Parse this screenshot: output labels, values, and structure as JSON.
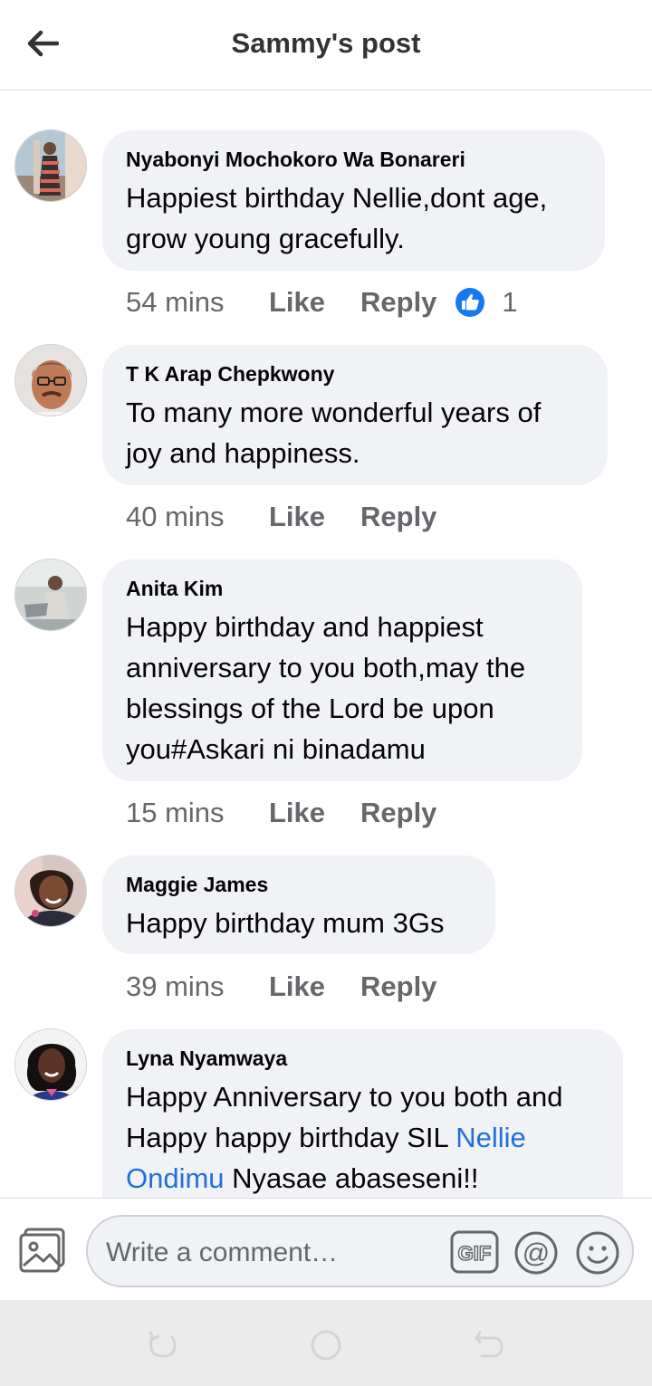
{
  "header": {
    "title": "Sammy's post"
  },
  "comments": [
    {
      "author": "Nyabonyi Mochokoro Wa Bonareri",
      "lines": [
        "Happiest birthday Nellie,dont age,",
        "grow young gracefully."
      ],
      "time": "54 mins",
      "like_label": "Like",
      "reply_label": "Reply",
      "reaction": {
        "icon": "thumbs-up-icon",
        "count": "1"
      }
    },
    {
      "author": "T K Arap Chepkwony",
      "lines": [
        "To many more wonderful years of",
        "joy and happiness."
      ],
      "time": "40 mins",
      "like_label": "Like",
      "reply_label": "Reply"
    },
    {
      "author": "Anita Kim",
      "lines": [
        "Happy birthday and happiest",
        "anniversary to you both,may the",
        "blessings of the Lord be upon",
        "you#Askari ni binadamu"
      ],
      "time": "15 mins",
      "like_label": "Like",
      "reply_label": "Reply"
    },
    {
      "author": "Maggie James",
      "lines": [
        "Happy birthday mum 3Gs"
      ],
      "time": "39 mins",
      "like_label": "Like",
      "reply_label": "Reply"
    },
    {
      "author": "Lyna Nyamwaya",
      "line1": "Happy Anniversary to you both and",
      "line2_pre": "Happy happy birthday SIL ",
      "mention_part1": "Nellie",
      "mention_part2": "Ondimu",
      "line3_post": " Nyasae abaseseni!!"
    }
  ],
  "composer": {
    "placeholder": "Write a comment…",
    "gif_label": "GIF",
    "at_label": "@"
  },
  "colors": {
    "mention": "#216fdb",
    "like_badge": "#1877f2",
    "bubble": "#f0f2f5",
    "meta_text": "#65676b"
  }
}
